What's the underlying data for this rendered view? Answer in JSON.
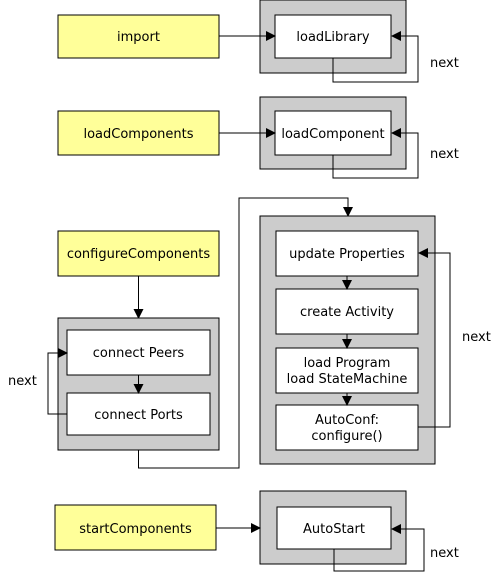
{
  "colors": {
    "step": "#ffff99",
    "group": "#cccccc",
    "task": "#ffffff",
    "line": "#000000"
  },
  "steps": {
    "import": "import",
    "loadComponents": "loadComponents",
    "configureComponents": "configureComponents",
    "startComponents": "startComponents"
  },
  "tasks": {
    "loadLibrary": "loadLibrary",
    "loadComponent": "loadComponent",
    "connectPeers": "connect Peers",
    "connectPorts": "connect Ports",
    "updateProperties": "update Properties",
    "createActivity": "create Activity",
    "loadProgram": [
      "load Program",
      "load StateMachine"
    ],
    "autoConf": [
      "AutoConf:",
      "configure()"
    ],
    "autoStart": "AutoStart"
  },
  "loop_label": "next"
}
